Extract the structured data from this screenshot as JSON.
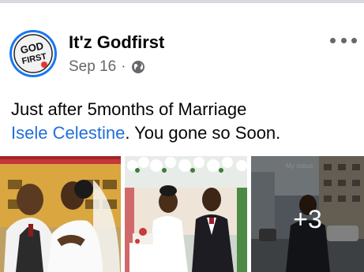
{
  "post": {
    "author": "It'z Godfirst",
    "avatar_text_line1": "GOD",
    "avatar_text_line2": "FIRST",
    "date": "Sep 16",
    "separator": "·",
    "privacy_icon": "globe-icon",
    "more_icon": "ellipsis-icon",
    "text_line1": "Just after 5months of Marriage",
    "mention": "Isele Celestine",
    "text_line2_rest": ". You gone so Soon."
  },
  "photos": {
    "count_overlay": "+3",
    "status_caption": "My status"
  },
  "colors": {
    "accent": "#1877f2",
    "link": "#216fdb",
    "muted": "#65676b"
  }
}
